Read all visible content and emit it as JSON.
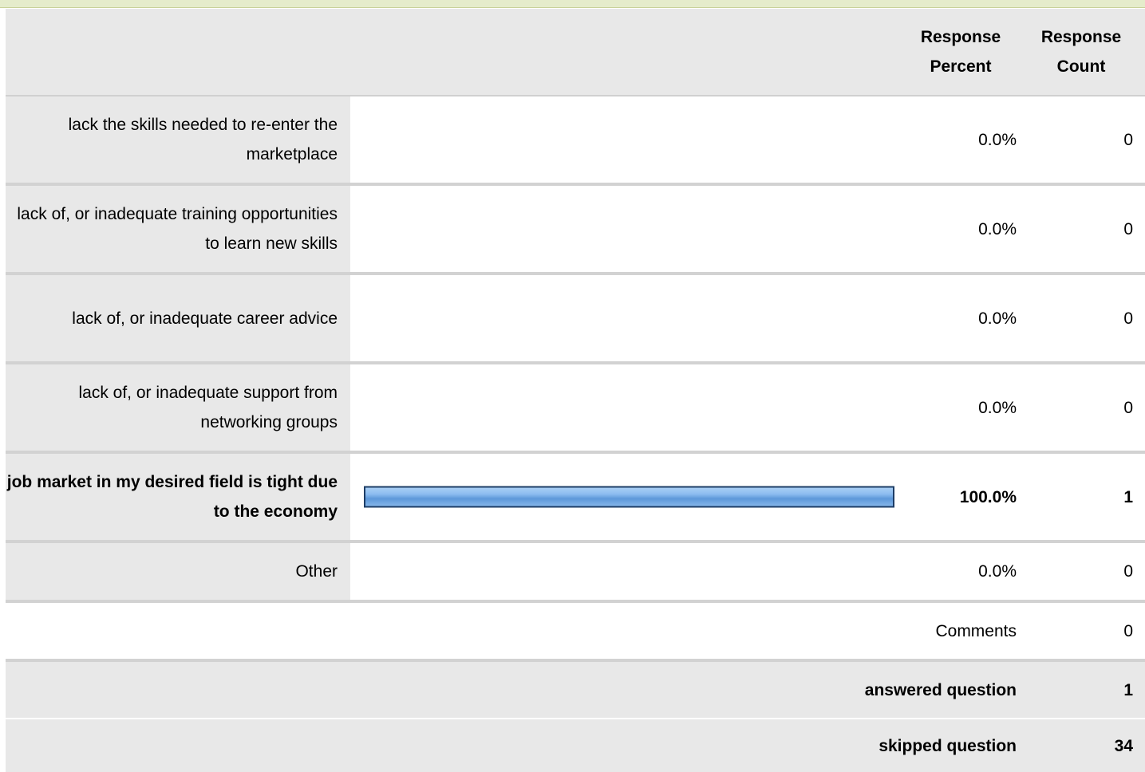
{
  "header": {
    "percent_label": "Response Percent",
    "percent_line1": "Response",
    "percent_line2": "Percent",
    "count_line1": "Response",
    "count_line2": "Count"
  },
  "answers": [
    {
      "label": "lack the skills needed to re-enter the marketplace",
      "percent": "0.0%",
      "count": "0",
      "fraction": 0.0,
      "highlight": false
    },
    {
      "label": "lack of, or inadequate training opportunities to learn new skills",
      "percent": "0.0%",
      "count": "0",
      "fraction": 0.0,
      "highlight": false
    },
    {
      "label": "lack of, or inadequate career advice",
      "percent": "0.0%",
      "count": "0",
      "fraction": 0.0,
      "highlight": false
    },
    {
      "label": "lack of, or inadequate support from networking groups",
      "percent": "0.0%",
      "count": "0",
      "fraction": 0.0,
      "highlight": false
    },
    {
      "label": "job market in my desired field is tight due to the economy",
      "percent": "100.0%",
      "count": "1",
      "fraction": 1.0,
      "highlight": true
    },
    {
      "label": "Other",
      "percent": "0.0%",
      "count": "0",
      "fraction": 0.0,
      "highlight": false
    }
  ],
  "comments": {
    "label": "Comments",
    "count": "0"
  },
  "answered": {
    "label": "answered question",
    "count": "1"
  },
  "skipped": {
    "label": "skipped question",
    "count": "34"
  },
  "colors": {
    "bar_fill": "#6fa6e2",
    "bar_border": "#1d3d66",
    "label_bg": "#e8e8e8",
    "top_strip": "#e5eccb"
  }
}
